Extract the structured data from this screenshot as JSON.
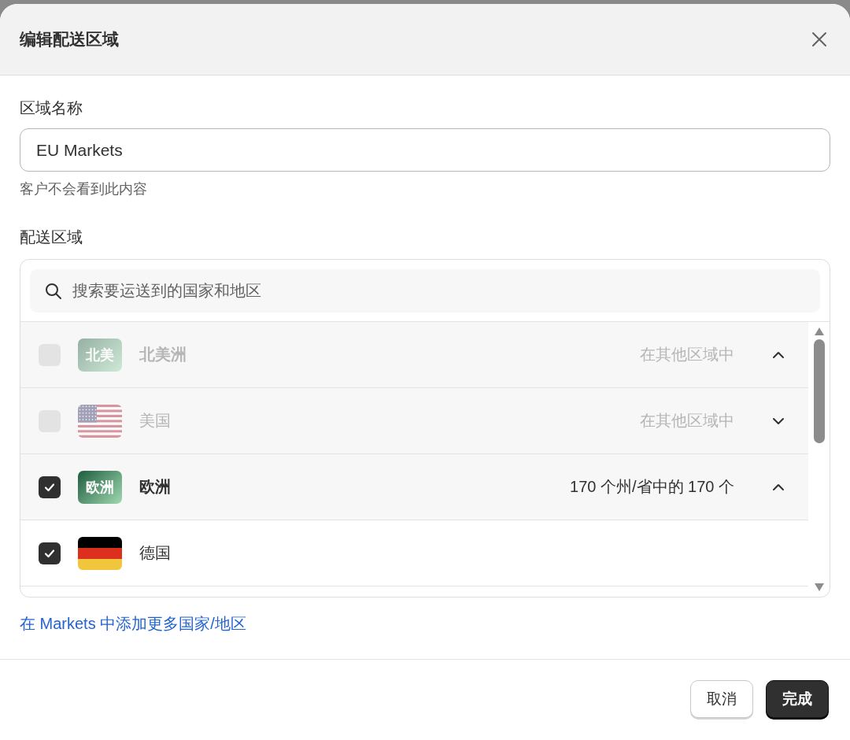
{
  "dialog": {
    "title": "编辑配送区域"
  },
  "zone_name": {
    "label": "区域名称",
    "value": "EU Markets",
    "hint": "客户不会看到此内容"
  },
  "zones": {
    "label": "配送区域",
    "search": {
      "placeholder": "搜索要运送到的国家和地区"
    },
    "items": [
      {
        "kind": "region",
        "badge": "北美",
        "name": "北美洲",
        "status": "在其他区域中",
        "checked": false,
        "disabled": true,
        "expanded": true
      },
      {
        "kind": "usflag",
        "name": "美国",
        "status": "在其他区域中",
        "checked": false,
        "disabled": true,
        "expanded": false
      },
      {
        "kind": "region",
        "badge": "欧洲",
        "name": "欧洲",
        "status": "170 个州/省中的 170 个",
        "checked": true,
        "disabled": false,
        "expanded": true
      },
      {
        "kind": "deflag",
        "name": "德国",
        "checked": true,
        "disabled": false
      }
    ]
  },
  "link": "在 Markets 中添加更多国家/地区",
  "buttons": [
    {
      "label": "取消",
      "kind": "secondary"
    },
    {
      "label": "完成",
      "kind": "primary"
    }
  ]
}
